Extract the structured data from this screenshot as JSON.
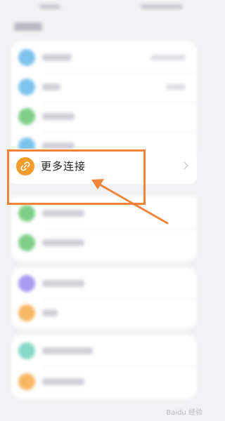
{
  "highlighted_item": {
    "label": "更多连接",
    "icon": "link-icon"
  },
  "annotation": {
    "box_color": "#f0843b",
    "arrow_color": "#f0843b"
  },
  "watermark": {
    "text": "Baidu 经验"
  },
  "icon_colors": {
    "blue": "#7ec3ec",
    "green": "#7fcf88",
    "purple": "#a99af2",
    "orange": "#f7b766",
    "teal": "#86dac7",
    "link_orange": "#f39c2b"
  }
}
